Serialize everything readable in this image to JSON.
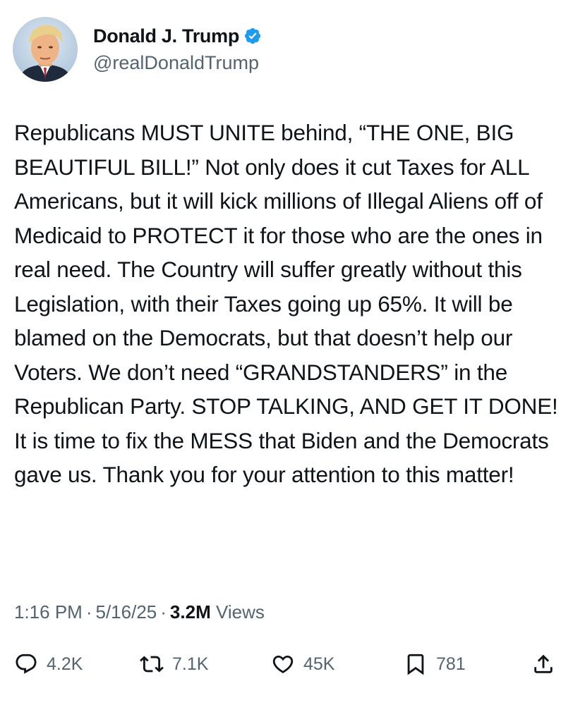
{
  "author": {
    "display_name": "Donald J. Trump",
    "handle": "@realDonaldTrump",
    "verified": true,
    "verified_color": "#1d9bf0"
  },
  "tweet": {
    "text": "Republicans MUST UNITE behind, “THE ONE, BIG BEAUTIFUL BILL!” Not only does it cut Taxes for ALL Americans, but it will kick millions of Illegal Aliens off of Medicaid to PROTECT it for those who are the ones in real need. The Country will suffer greatly without this Legislation, with their Taxes going up 65%. It will be blamed on the Democrats, but that doesn’t help our Voters. We don’t need “GRANDSTANDERS” in the Republican Party. STOP TALKING, AND GET IT DONE! It is time to fix the MESS that Biden and the Democrats gave us. Thank you for your attention to this matter!"
  },
  "meta": {
    "time": "1:16 PM",
    "separator": "·",
    "date": "5/16/25",
    "views_count": "3.2M",
    "views_label": "Views"
  },
  "actions": {
    "reply": {
      "icon": "reply-icon",
      "count": "4.2K"
    },
    "repost": {
      "icon": "repost-icon",
      "count": "7.1K"
    },
    "like": {
      "icon": "heart-icon",
      "count": "45K"
    },
    "bookmark": {
      "icon": "bookmark-icon",
      "count": "781"
    },
    "share": {
      "icon": "share-icon"
    }
  },
  "colors": {
    "text_primary": "#0f1419",
    "text_secondary": "#536471",
    "accent": "#1d9bf0"
  }
}
